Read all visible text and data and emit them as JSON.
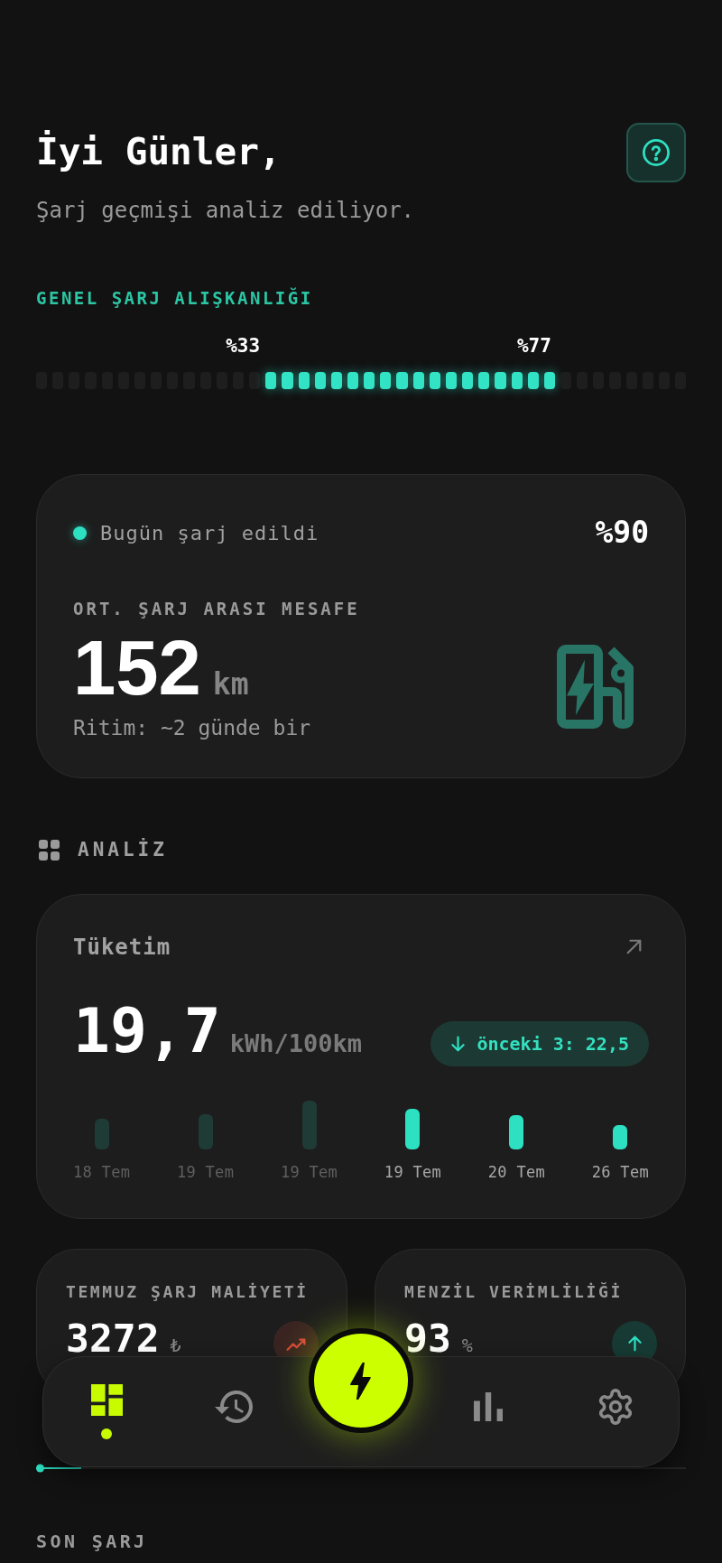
{
  "header": {
    "greeting": "İyi Günler,",
    "subtitle": "Şarj geçmişi analiz ediliyor."
  },
  "habit": {
    "title": "GENEL ŞARJ ALIŞKANLIĞI",
    "start_label": "%33",
    "end_label": "%77",
    "segments": [
      {
        "active": false
      },
      {
        "active": false
      },
      {
        "active": false
      },
      {
        "active": false
      },
      {
        "active": false
      },
      {
        "active": false
      },
      {
        "active": false
      },
      {
        "active": false
      },
      {
        "active": false
      },
      {
        "active": false
      },
      {
        "active": false
      },
      {
        "active": false
      },
      {
        "active": false
      },
      {
        "active": false
      },
      {
        "active": true
      },
      {
        "active": true
      },
      {
        "active": true
      },
      {
        "active": true
      },
      {
        "active": true
      },
      {
        "active": true
      },
      {
        "active": true
      },
      {
        "active": true
      },
      {
        "active": true
      },
      {
        "active": true
      },
      {
        "active": true
      },
      {
        "active": true
      },
      {
        "active": true
      },
      {
        "active": true
      },
      {
        "active": true
      },
      {
        "active": true
      },
      {
        "active": true
      },
      {
        "active": true
      },
      {
        "active": false
      },
      {
        "active": false
      },
      {
        "active": false
      },
      {
        "active": false
      },
      {
        "active": false
      },
      {
        "active": false
      },
      {
        "active": false
      },
      {
        "active": false
      }
    ]
  },
  "today_card": {
    "status": "Bugün şarj edildi",
    "battery": "%90",
    "label": "ORT. ŞARJ ARASI MESAFE",
    "value": "152",
    "unit": "km",
    "rhythm": "Ritim: ~2 günde bir"
  },
  "analysis": {
    "title": "ANALİZ"
  },
  "consumption": {
    "title": "Tüketim",
    "value": "19,7",
    "unit": "kWh/100km",
    "comparison": "önceki 3: 22,5",
    "bars": [
      {
        "label": "18 Tem",
        "active": false
      },
      {
        "label": "19 Tem",
        "active": false
      },
      {
        "label": "19 Tem",
        "active": false
      },
      {
        "label": "19 Tem",
        "active": true
      },
      {
        "label": "20 Tem",
        "active": true
      },
      {
        "label": "26 Tem",
        "active": true
      }
    ]
  },
  "stats": [
    {
      "kind": "negative",
      "title": "TEMMUZ ŞARJ MALİYETİ",
      "value": "3272",
      "unit": "₺"
    },
    {
      "kind": "positive",
      "title": "MENZİL VERİMLİLİĞİ",
      "value": "93",
      "unit": "%"
    }
  ],
  "timeline": {
    "level": 0.07
  },
  "last_charge": {
    "title": "SON ŞARJ"
  },
  "nav": {
    "items": [
      {
        "selected": true
      },
      {
        "selected": false
      },
      {
        "selected": false
      },
      {
        "selected": false
      }
    ]
  }
}
